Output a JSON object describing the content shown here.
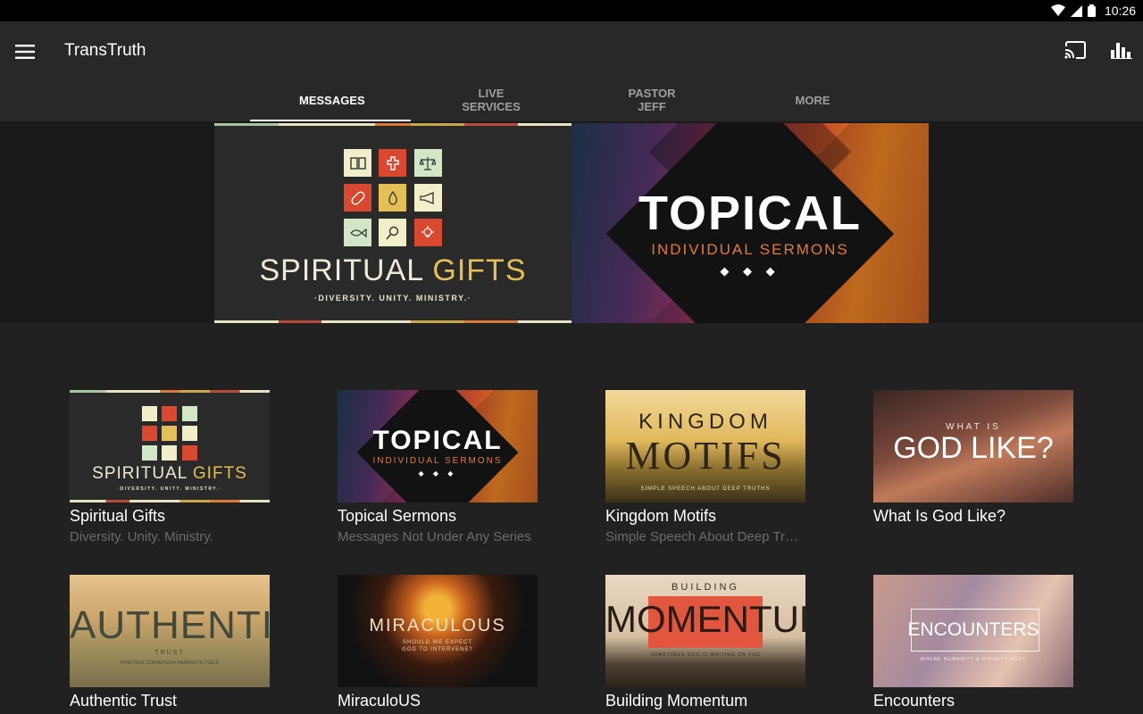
{
  "status_bar": {
    "time": "10:26"
  },
  "app_bar": {
    "title": "TransTruth",
    "cast_icon": "cast-icon",
    "stats_icon": "bar-chart-icon",
    "menu_icon": "menu-icon"
  },
  "tabs": [
    {
      "label": "MESSAGES",
      "active": true
    },
    {
      "label": "LIVE SERVICES",
      "active": false
    },
    {
      "label": "PASTOR JEFF",
      "active": false
    },
    {
      "label": "MORE",
      "active": false
    }
  ],
  "hero": {
    "spiritual_gifts": {
      "title_a": "SPIRITUAL ",
      "title_b": "GIFTS",
      "subtitle": "·DIVERSITY. UNITY. MINISTRY.·"
    },
    "topical": {
      "title": "TOPICAL",
      "subtitle": "INDIVIDUAL SERMONS",
      "dots": "◆ ◆ ◆"
    }
  },
  "series": [
    {
      "title": "Spiritual Gifts",
      "subtitle": "Diversity. Unity. Ministry.",
      "art": {
        "title_a": "SPIRITUAL ",
        "title_b": "GIFTS",
        "sub": "·DIVERSITY. UNITY. MINISTRY.·"
      }
    },
    {
      "title": "Topical Sermons",
      "subtitle": "Messages Not Under Any Series",
      "art": {
        "title": "TOPICAL",
        "sub": "INDIVIDUAL SERMONS",
        "dots": "◆ ◆ ◆"
      }
    },
    {
      "title": "Kingdom Motifs",
      "subtitle": "Simple Speech About Deep Trut...",
      "art": {
        "line1": "KINGDOM",
        "line2": "MOTIFS",
        "sub": "SIMPLE SPEECH ABOUT DEEP TRUTHS"
      }
    },
    {
      "title": "What Is God Like?",
      "subtitle": "",
      "art": {
        "line1": "WHAT IS",
        "line2": "GOD LIKE?"
      }
    },
    {
      "title": "Authentic Trust",
      "subtitle": "",
      "art": {
        "line1": "AUTHENTIC",
        "line2": "TRUST",
        "sub": "HOW TRUE CONVERSION MANIFESTS ITSELF"
      }
    },
    {
      "title": "MiraculoUS",
      "subtitle": "",
      "art": {
        "line1": "MIRACULOUS",
        "sub1": "SHOULD WE EXPECT",
        "sub2": "GOD TO INTERVENE?"
      }
    },
    {
      "title": "Building Momentum",
      "subtitle": "",
      "art": {
        "line1": "BUILDING",
        "line2": "MOMENTUM",
        "sub": "SOMETIMES GOD IS WAITING ON YOU"
      }
    },
    {
      "title": "Encounters",
      "subtitle": "",
      "art": {
        "line1": "ENCOUNTERS",
        "sub": "WHERE HUMANITY & DIVINITY MEET"
      }
    }
  ],
  "colors": {
    "background": "#212121",
    "app_bar": "#282828",
    "gold": "#e3bf55",
    "orange": "#e47b32"
  }
}
